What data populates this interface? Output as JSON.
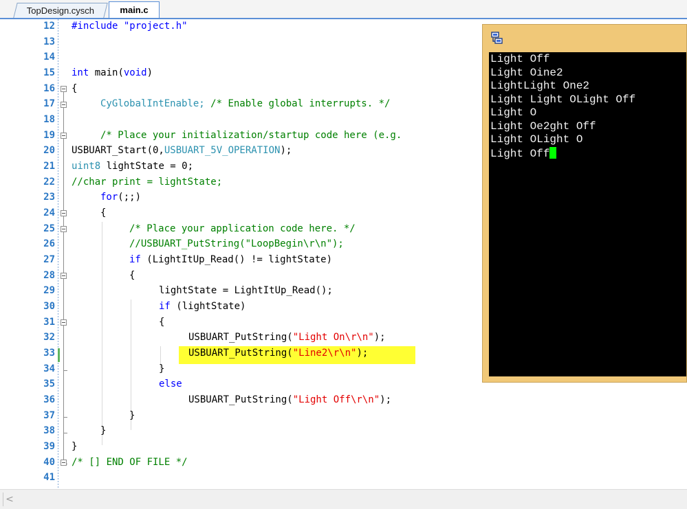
{
  "tabs": [
    {
      "label": "TopDesign.cysch",
      "active": false
    },
    {
      "label": "main.c",
      "active": true
    }
  ],
  "editor": {
    "line_numbers": [
      "12",
      "13",
      "14",
      "15",
      "16",
      "17",
      "18",
      "19",
      "20",
      "21",
      "22",
      "23",
      "24",
      "25",
      "26",
      "27",
      "28",
      "29",
      "30",
      "31",
      "32",
      "33",
      "34",
      "35",
      "36",
      "37",
      "38",
      "39",
      "40",
      "41"
    ],
    "lines": {
      "l12": {
        "a": "#include \"project.h\""
      },
      "l15": {
        "a": "int",
        "b": " main(",
        "c": "void",
        "d": ")"
      },
      "l16": {
        "a": "{"
      },
      "l17": {
        "a": "CyGlobalIntEnable; ",
        "b": "/* Enable global interrupts. */"
      },
      "l19": {
        "a": "/* Place your initialization/startup code here (e.g."
      },
      "l20": {
        "a": "USBUART_Start(0,",
        "b": "USBUART_5V_OPERATION",
        "c": ");"
      },
      "l21": {
        "a": "uint8",
        "b": " lightState = 0;"
      },
      "l22": {
        "a": "//char print = lightState;"
      },
      "l23": {
        "a": "for",
        "b": "(;;)"
      },
      "l24": {
        "a": "{"
      },
      "l25": {
        "a": "/* Place your application code here. */"
      },
      "l26": {
        "a": "//USBUART_PutString(\"LoopBegin\\r\\n\");"
      },
      "l27": {
        "a": "if",
        "b": " (LightItUp_Read() != lightState)"
      },
      "l28": {
        "a": "{"
      },
      "l29": {
        "a": "lightState = LightItUp_Read();"
      },
      "l30": {
        "a": "if",
        "b": " (lightState)"
      },
      "l31": {
        "a": "{"
      },
      "l32": {
        "a": "USBUART_PutString(",
        "b": "\"Light On\\r\\n\"",
        "c": ");"
      },
      "l33": {
        "a": "USBUART_PutString(",
        "b": "\"Line2\\r\\n\"",
        "c": ");"
      },
      "l34": {
        "a": "}"
      },
      "l35": {
        "a": "else"
      },
      "l36": {
        "a": "USBUART_PutString(",
        "b": "\"Light Off\\r\\n\"",
        "c": ");"
      },
      "l37": {
        "a": "}"
      },
      "l38": {
        "a": "}"
      },
      "l39": {
        "a": "}"
      },
      "l40": {
        "a": "/* [] END OF FILE */"
      }
    }
  },
  "terminal": {
    "icon": "terminal-window-icon",
    "lines": [
      "Light Off",
      "Light Oine2",
      "LightLight One2",
      "Light Light OLight Off",
      "Light O",
      "Light Oe2ght Off",
      "Light OLight O",
      "Light Off"
    ]
  },
  "scrollbar": {
    "left_arrow": "<"
  },
  "colors": {
    "keyword": "#0000ff",
    "type": "#2b91af",
    "comment": "#008000",
    "string": "#e30000",
    "highlight": "#ffff33",
    "line_number": "#2b78c5",
    "terminal_frame": "#f0c878",
    "cursor": "#00ff00"
  }
}
